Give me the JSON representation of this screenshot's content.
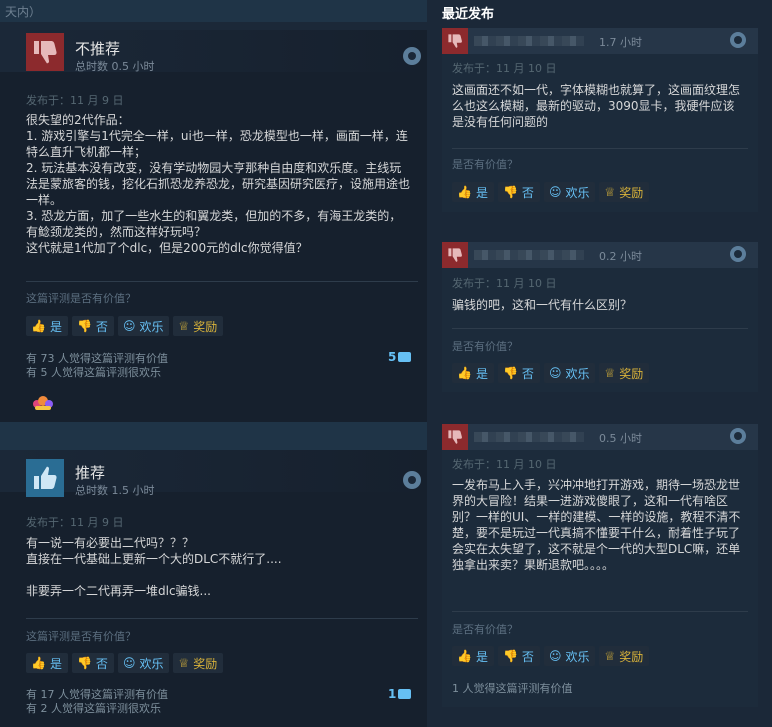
{
  "header": {
    "left_cut_text": "天内）",
    "recent_title": "最近发布"
  },
  "reviews": [
    {
      "verdict": "不推荐",
      "hours": "总时数 0.5 小时",
      "posted": "发布于：11 月 9 日",
      "body": "很失望的2代作品：\n1. 游戏引擎与1代完全一样，ui也一样，恐龙模型也一样，画面一样，连特么直升飞机都一样；\n2. 玩法基本没有改变，没有学动物园大亨那种自由度和欢乐度。主线玩法是蒙旅客的钱，挖化石抓恐龙养恐龙，研究基因研究医疗，设施用途也一样。\n3. 恐龙方面，加了一些水生的和翼龙类，但加的不多，有海王龙类的，有鲶颈龙类的，然而这样好玩吗？\n这代就是1代加了个dlc，但是200元的dlc你觉得值？",
      "helpful_q": "这篇评测是否有价值？",
      "stats_helpful": "有 73 人觉得这篇评测有价值",
      "stats_funny": "有 5 人觉得这篇评测很欢乐",
      "comments": "5"
    },
    {
      "verdict": "推荐",
      "hours": "总时数 1.5 小时",
      "posted": "发布于：11 月 9 日",
      "body": "有一说一有必要出二代吗？？？\n直接在一代基础上更新一个大的DLC不就行了....\n\n非要弄一个二代再弄一堆dlc骗钱...",
      "helpful_q": "这篇评测是否有价值？",
      "stats_helpful": "有 17 人觉得这篇评测有价值",
      "stats_funny": "有 2 人觉得这篇评测很欢乐",
      "comments": "1"
    }
  ],
  "recent": [
    {
      "hours": "1.7 小时",
      "posted": "发布于：11 月 10 日",
      "body": "这画面还不如一代，字体模糊也就算了，这画面纹理怎么也这么模糊，最新的驱动，3090显卡，我硬件应该是没有任何问题的",
      "helpful_q": "是否有价值？",
      "stats": ""
    },
    {
      "hours": "0.2 小时",
      "posted": "发布于：11 月 10 日",
      "body": "骗钱的吧，这和一代有什么区别？",
      "helpful_q": "是否有价值？",
      "stats": ""
    },
    {
      "hours": "0.5 小时",
      "posted": "发布于：11 月 10 日",
      "body": "一发布马上入手，兴冲冲地打开游戏，期待一场恐龙世界的大冒险！结果一进游戏傻眼了，这和一代有啥区别？一样的UI、一样的建模、一样的设施，教程不清不楚，要不是玩过一代真搞不懂要干什么，耐着性子玩了会实在太失望了，这不就是个一代的大型DLC嘛，还单独拿出来卖？果断退款吧。。。。",
      "helpful_q": "是否有价值？",
      "stats": "1 人觉得这篇评测有价值"
    }
  ],
  "buttons": {
    "yes": "是",
    "no": "否",
    "funny": "欢乐",
    "award": "奖励"
  },
  "colors": {
    "background": "#1b2838",
    "accent": "#66c0f4",
    "negative": "#8c2a2d",
    "positive": "#2a6d94",
    "award": "#d9b33a"
  }
}
